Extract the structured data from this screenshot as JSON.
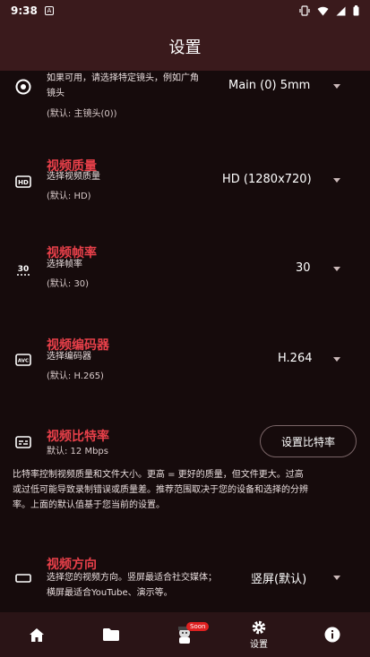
{
  "status_bar": {
    "time": "9:38",
    "notification_icon": "A"
  },
  "app_bar": {
    "title": "设置"
  },
  "camera": {
    "description_line1": "如果可用，请选择特定镜头，例如广角",
    "description_line2": "镜头",
    "default": "(默认: 主镜头(0))",
    "value": "Main (0) 5mm"
  },
  "quality": {
    "title": "视频质量",
    "subtitle": "选择视频质量",
    "default": "(默认: HD)",
    "value": "HD (1280x720)"
  },
  "framerate": {
    "title": "视频帧率",
    "subtitle": "选择帧率",
    "default": "(默认: 30)",
    "value": "30"
  },
  "encoder": {
    "title": "视频编码器",
    "subtitle": "选择编码器",
    "default": "(默认: H.265)",
    "value": "H.264"
  },
  "bitrate": {
    "title": "视频比特率",
    "default": "默认: 12 Mbps",
    "button_label": "设置比特率",
    "description_line1": "比特率控制视频质量和文件大小。更高 = 更好的质量，但文件更大。过高",
    "description_line2": "或过低可能导致录制错误或质量差。推荐范围取决于您的设备和选择的分辨",
    "description_line3": "率。上面的默认值基于您当前的设置。"
  },
  "orientation": {
    "title": "视频方向",
    "subtitle_line1": "选择您的视频方向。竖屏最适合社交媒体；",
    "subtitle_line2": "横屏最适合YouTube、演示等。",
    "value": "竖屏(默认)"
  },
  "bottom_nav": {
    "soon_badge": "Soon",
    "settings_label": "设置"
  },
  "colors": {
    "accent_red": "#e8404a",
    "app_bar": "#3a1a1c",
    "background": "#160b0c"
  }
}
